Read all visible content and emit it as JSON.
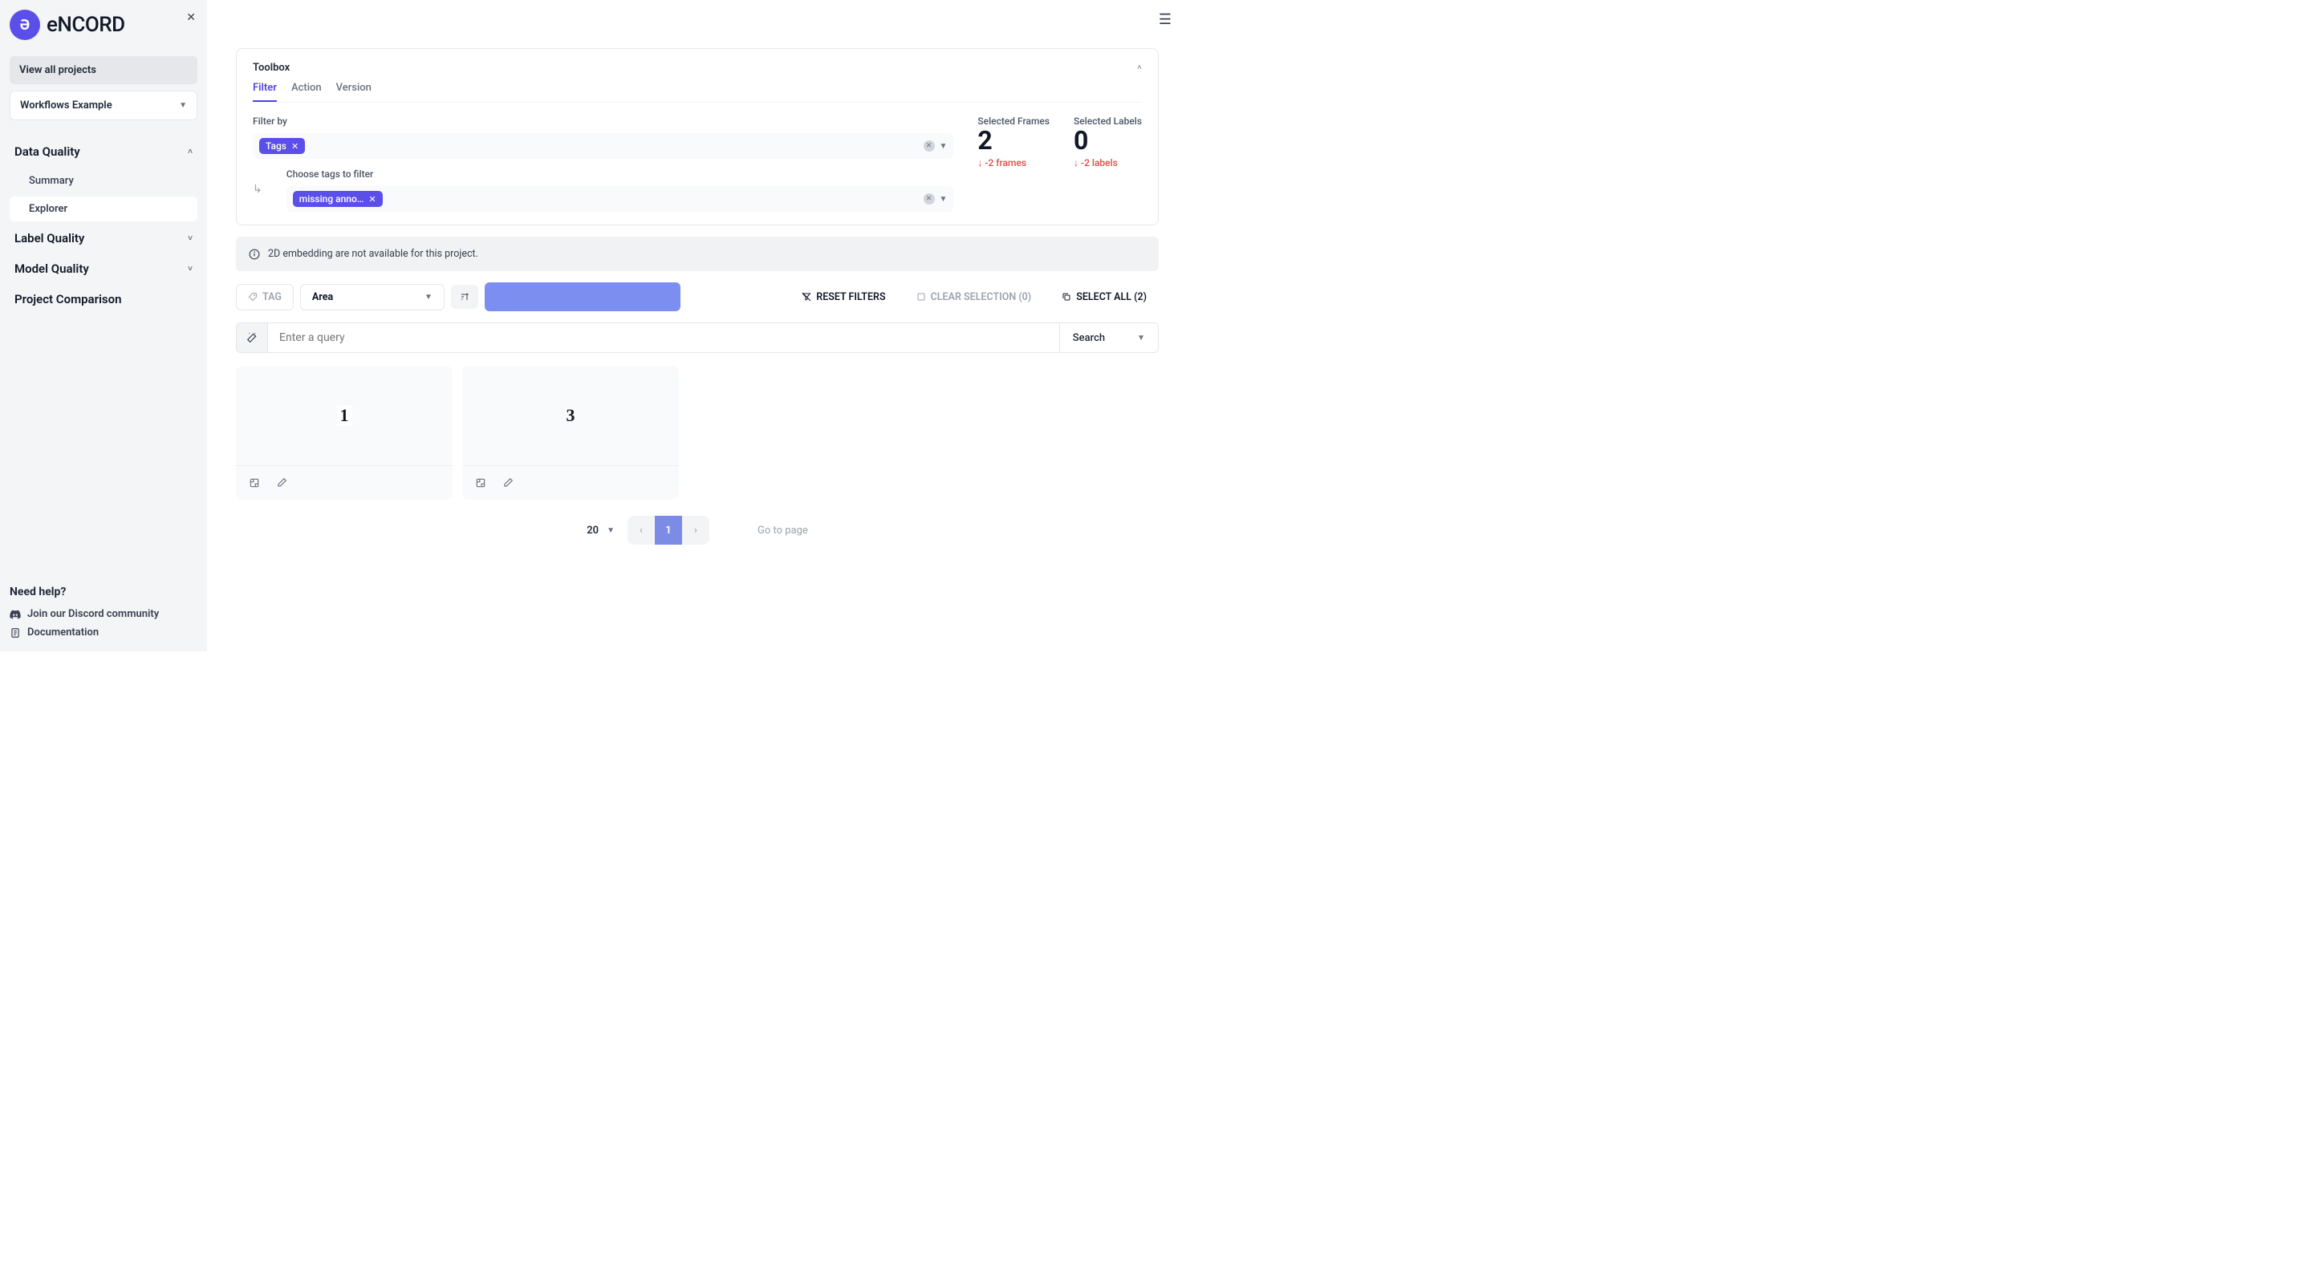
{
  "brand": "eNCORD",
  "sidebar": {
    "all_projects": "View all projects",
    "project_name": "Workflows Example",
    "nav": {
      "data_quality": "Data Quality",
      "summary": "Summary",
      "explorer": "Explorer",
      "label_quality": "Label Quality",
      "model_quality": "Model Quality",
      "project_comparison": "Project Comparison"
    },
    "help": {
      "title": "Need help?",
      "discord": "Join our Discord community",
      "docs": "Documentation"
    }
  },
  "toolbox": {
    "title": "Toolbox",
    "tabs": {
      "filter": "Filter",
      "action": "Action",
      "version": "Version"
    },
    "filter_by_label": "Filter by",
    "chips": {
      "tags": "Tags",
      "missing": "missing annotati…"
    },
    "choose_tags": "Choose tags to filter",
    "stats": {
      "frames_label": "Selected Frames",
      "frames_value": "2",
      "frames_delta": "↓ -2 frames",
      "labels_label": "Selected Labels",
      "labels_value": "0",
      "labels_delta": "↓ -2 labels"
    }
  },
  "banner": "2D embedding are not available for this project.",
  "actions": {
    "tag": "TAG",
    "area": "Area",
    "reset": "RESET FILTERS",
    "clear": "CLEAR SELECTION (0)",
    "select_all": "SELECT ALL (2)"
  },
  "search": {
    "placeholder": "Enter a query",
    "mode": "Search"
  },
  "cards": [
    {
      "digit": "1"
    },
    {
      "digit": "3"
    }
  ],
  "pagination": {
    "size": "20",
    "page": "1",
    "goto": "Go to page"
  }
}
